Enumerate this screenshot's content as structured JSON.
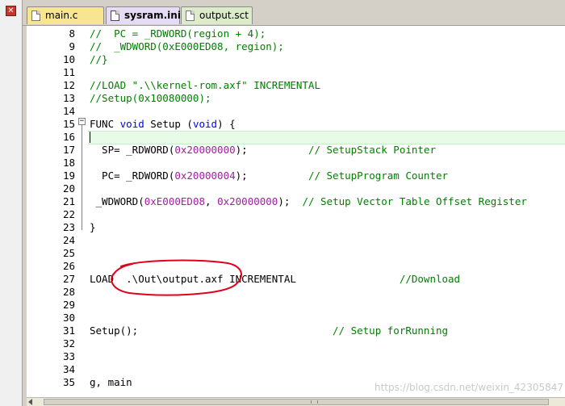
{
  "window": {
    "close_glyph": "✕"
  },
  "tabs": [
    {
      "label": "main.c",
      "active": false,
      "color": "#f7e591"
    },
    {
      "label": "sysram.ini",
      "active": true,
      "color": "#e6dbf4"
    },
    {
      "label": "output.sct",
      "active": false,
      "color": "#dcebc8"
    }
  ],
  "editor": {
    "fold_glyph": "−",
    "current_line": 16,
    "colors": {
      "comment": "#008000",
      "keyword": "#0000ff",
      "number": "#a020a0",
      "current_line_bg": "#e8fbe8",
      "annotation": "#e0001a"
    },
    "line_numbers": [
      "8",
      "9",
      "10",
      "11",
      "12",
      "13",
      "14",
      "15",
      "16",
      "17",
      "18",
      "19",
      "20",
      "21",
      "22",
      "23",
      "24",
      "25",
      "26",
      "27",
      "28",
      "29",
      "30",
      "31",
      "32",
      "33",
      "34",
      "35"
    ],
    "lines": {
      "l8": "//  PC = _RDWORD(region + 4);",
      "l9": "//  _WDWORD(0xE000ED08, region);",
      "l10": "//}",
      "l12": "//LOAD \".\\\\kernel-rom.axf\" INCREMENTAL",
      "l13": "//Setup(0x10080000);",
      "l15_func": "FUNC ",
      "l15_void": "void",
      "l15_setup": " Setup (",
      "l15_void2": "void",
      "l15_end": ") {",
      "l17_a": "  SP= _RDWORD(",
      "l17_num": "0x20000000",
      "l17_b": ");          ",
      "l17_cm": "// SetupStack Pointer",
      "l19_a": "  PC= _RDWORD(",
      "l19_num": "0x20000004",
      "l19_b": ");          ",
      "l19_cm": "// SetupProgram Counter",
      "l21_a": " _WDWORD(",
      "l21_num1": "0xE000ED08",
      "l21_b": ", ",
      "l21_num2": "0x20000000",
      "l21_c": ");  ",
      "l21_cm": "// Setup Vector Table Offset Register",
      "l23": "}",
      "l27_a": "LOAD  .\\Out\\output.axf INCREMENTAL                 ",
      "l27_cm": "//Download",
      "l31_a": "Setup();                                ",
      "l31_cm": "// Setup forRunning",
      "l35": "g, main"
    }
  },
  "watermark": "https://blog.csdn.net/weixin_42305847"
}
